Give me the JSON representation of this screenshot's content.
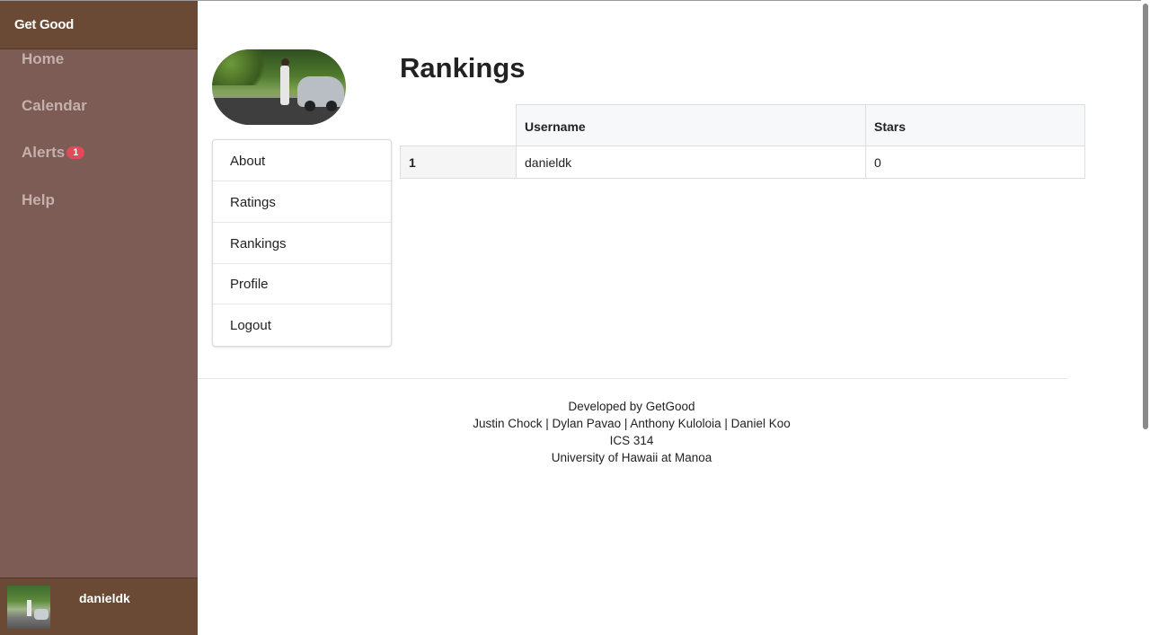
{
  "sidebar": {
    "brand": "Get Good",
    "items": [
      {
        "label": "Home"
      },
      {
        "label": "Calendar"
      },
      {
        "label": "Alerts",
        "badge": "1"
      },
      {
        "label": "Help"
      }
    ],
    "user": {
      "name": "danieldk"
    }
  },
  "profile_menu": {
    "items": [
      {
        "label": "About"
      },
      {
        "label": "Ratings"
      },
      {
        "label": "Rankings"
      },
      {
        "label": "Profile"
      },
      {
        "label": "Logout"
      }
    ]
  },
  "rankings": {
    "title": "Rankings",
    "columns": [
      "",
      "Username",
      "Stars"
    ],
    "rows": [
      {
        "rank": "1",
        "username": "danieldk",
        "stars": "0"
      }
    ]
  },
  "footer": {
    "line1": "Developed by GetGood",
    "line2": "Justin Chock | Dylan Pavao | Anthony Kuloloia | Daniel Koo",
    "line3": "ICS 314",
    "line4": "University of Hawaii at Manoa"
  },
  "colors": {
    "sidebar_bg": "#7c5c55",
    "brand_bg": "#6a4a34",
    "nav_text": "#c5b0ab",
    "badge": "#e24a5a"
  }
}
